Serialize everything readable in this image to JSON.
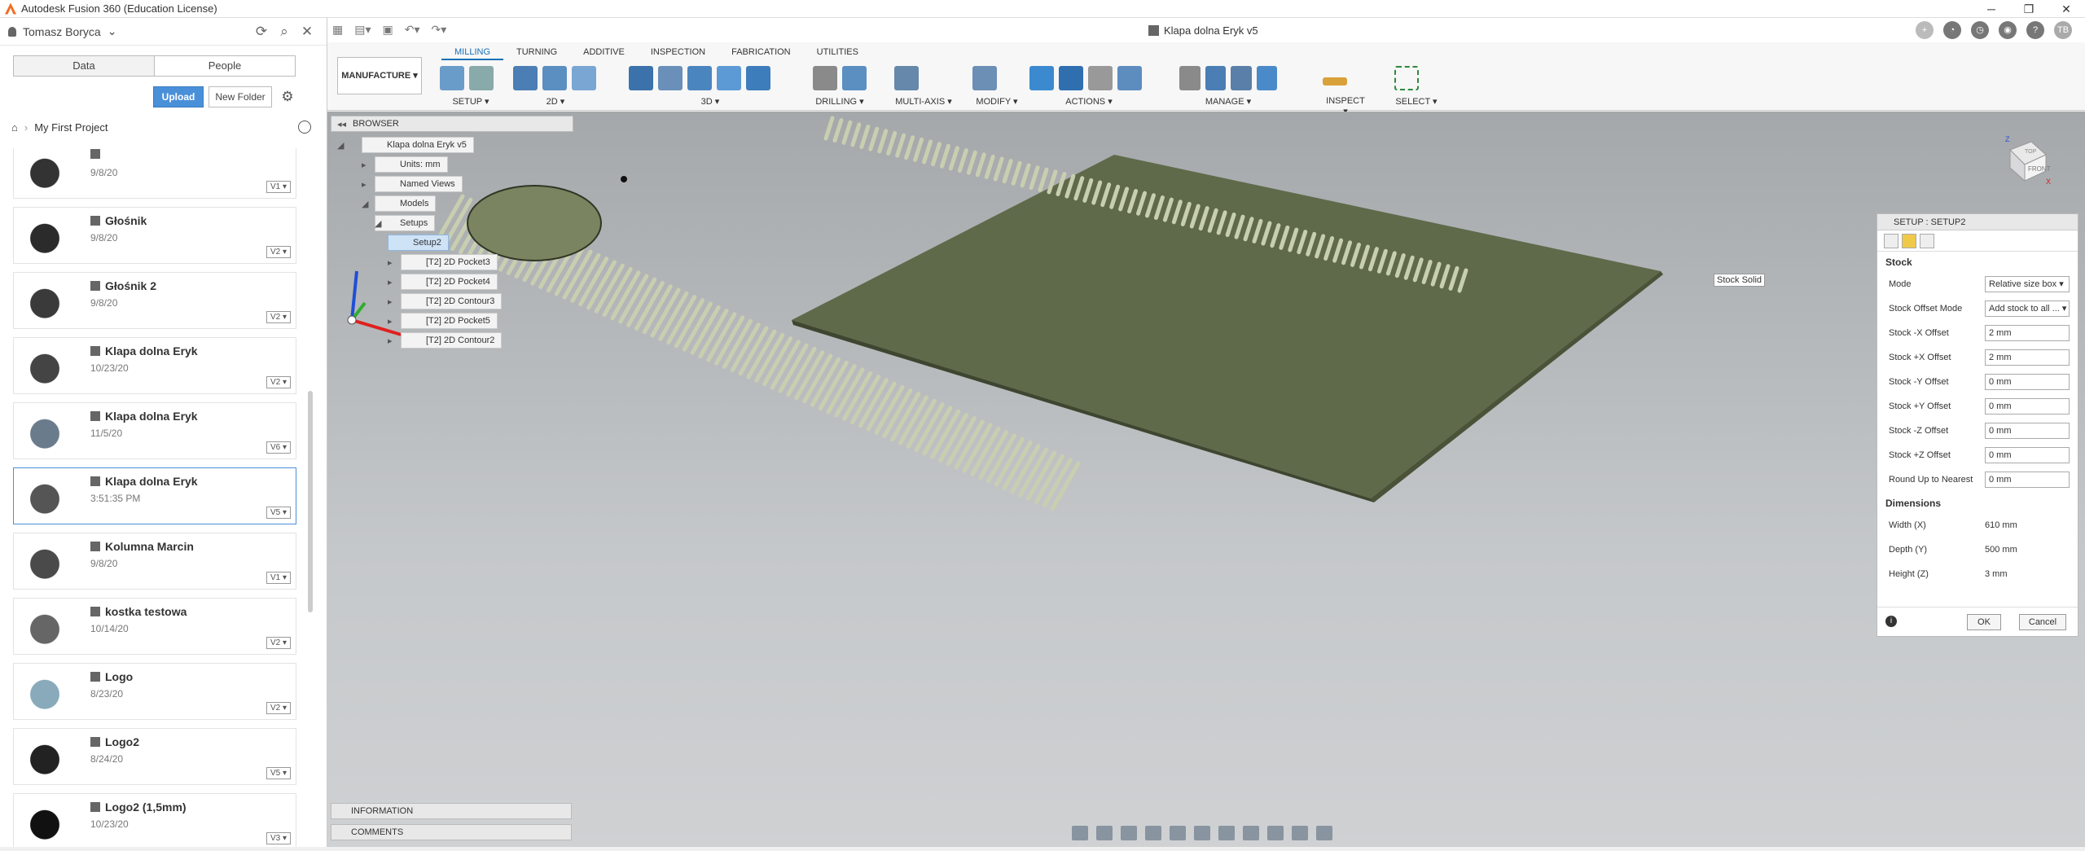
{
  "window": {
    "title": "Autodesk Fusion 360 (Education License)",
    "minimize": "─",
    "restore": "❐",
    "close": "✕"
  },
  "data_panel": {
    "user": "Tomasz Boryca",
    "tabs": {
      "data": "Data",
      "people": "People"
    },
    "upload_label": "Upload",
    "new_folder_label": "New Folder",
    "breadcrumb": "My First Project",
    "files": [
      {
        "name": "",
        "date": "9/8/20",
        "version": "V1"
      },
      {
        "name": "Głośnik",
        "date": "9/8/20",
        "version": "V2"
      },
      {
        "name": "Głośnik 2",
        "date": "9/8/20",
        "version": "V2"
      },
      {
        "name": "Klapa dolna Eryk",
        "date": "10/23/20",
        "version": "V2"
      },
      {
        "name": "Klapa dolna Eryk",
        "date": "11/5/20",
        "version": "V6"
      },
      {
        "name": "Klapa dolna Eryk",
        "date": "3:51:35 PM",
        "version": "V5"
      },
      {
        "name": "Kolumna Marcin",
        "date": "9/8/20",
        "version": "V1"
      },
      {
        "name": "kostka testowa",
        "date": "10/14/20",
        "version": "V2"
      },
      {
        "name": "Logo",
        "date": "8/23/20",
        "version": "V2"
      },
      {
        "name": "Logo2",
        "date": "8/24/20",
        "version": "V5"
      },
      {
        "name": "Logo2 (1,5mm)",
        "date": "10/23/20",
        "version": "V3"
      }
    ]
  },
  "document": {
    "title": "Klapa dolna Eryk v5",
    "close": "✕",
    "user_initials": "TB"
  },
  "ribbon": {
    "workspace": "MANUFACTURE ▾",
    "tabs": [
      "MILLING",
      "TURNING",
      "ADDITIVE",
      "INSPECTION",
      "FABRICATION",
      "UTILITIES"
    ],
    "groups": [
      "SETUP ▾",
      "2D ▾",
      "3D ▾",
      "DRILLING ▾",
      "MULTI-AXIS ▾",
      "MODIFY ▾",
      "ACTIONS ▾",
      "MANAGE ▾",
      "INSPECT ▾",
      "SELECT ▾"
    ]
  },
  "browser": {
    "header": "BROWSER",
    "root": "Klapa dolna Eryk v5",
    "units": "Units: mm",
    "named_views": "Named Views",
    "models": "Models",
    "setups": "Setups",
    "setup": "Setup2",
    "operations": [
      "[T2] 2D Pocket3",
      "[T2] 2D Pocket4",
      "[T2] 2D Contour3",
      "[T2] 2D Pocket5",
      "[T2] 2D Contour2"
    ]
  },
  "panels": {
    "information": "INFORMATION",
    "comments": "COMMENTS"
  },
  "viewcube": {
    "top": "TOP",
    "front": "FRONT",
    "z": "Z",
    "x": "X"
  },
  "tooltip": "Stock Solid",
  "setup_dialog": {
    "title": "SETUP : SETUP2",
    "stock_section": "Stock",
    "rows": [
      {
        "label": "Mode",
        "value": "Relative size box ▾"
      },
      {
        "label": "Stock Offset Mode",
        "value": "Add stock to all ... ▾"
      },
      {
        "label": "Stock -X Offset",
        "value": "2 mm"
      },
      {
        "label": "Stock +X Offset",
        "value": "2 mm"
      },
      {
        "label": "Stock -Y Offset",
        "value": "0 mm"
      },
      {
        "label": "Stock +Y Offset",
        "value": "0 mm"
      },
      {
        "label": "Stock -Z Offset",
        "value": "0 mm"
      },
      {
        "label": "Stock +Z Offset",
        "value": "0 mm"
      },
      {
        "label": "Round Up to Nearest",
        "value": "0 mm"
      }
    ],
    "dimensions_section": "Dimensions",
    "dims": [
      {
        "label": "Width (X)",
        "value": "610 mm"
      },
      {
        "label": "Depth (Y)",
        "value": "500 mm"
      },
      {
        "label": "Height (Z)",
        "value": "3 mm"
      }
    ],
    "ok": "OK",
    "cancel": "Cancel"
  },
  "colors": {
    "accent": "#1a6fb5",
    "part": "#5f6a4a",
    "part_edge": "#3f4630",
    "background_top": "#a4a8ab"
  }
}
